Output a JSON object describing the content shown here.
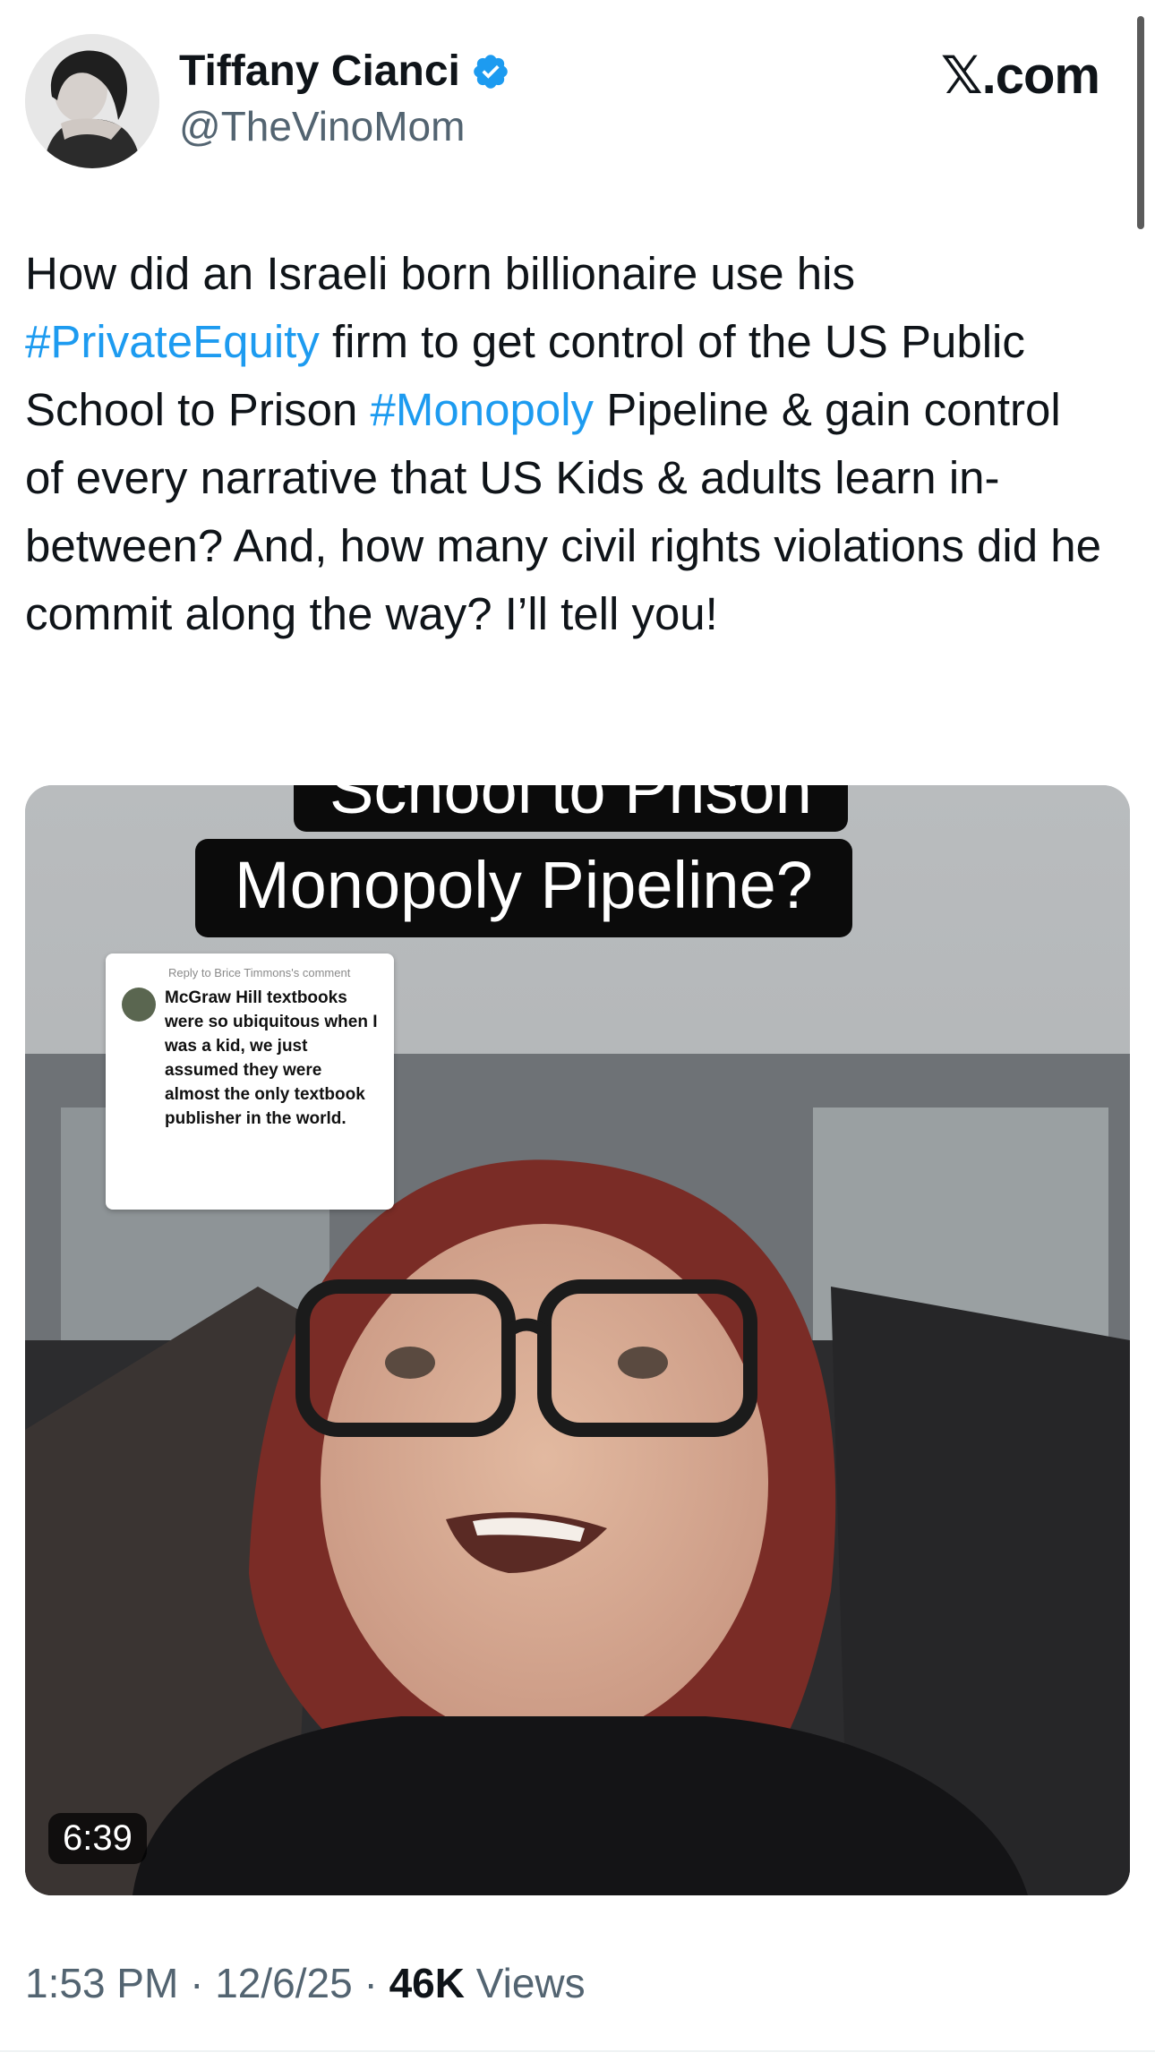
{
  "author": {
    "display_name": "Tiffany Cianci",
    "handle": "@TheVinoMom",
    "avatar_icon": "profile-photo",
    "verified_icon": "verified-badge-icon",
    "verified_color": "#1d9bf0"
  },
  "source_label": "𝕏.com",
  "tweet": {
    "text_1": "How did an Israeli born billionaire use his ",
    "hashtag_1": "#PrivateEquity",
    "text_2": " firm to get control of the US Public School to Prison ",
    "hashtag_2": "#Monopoly",
    "text_3": " Pipeline & gain control of every narrative that US Kids & adults learn in-between? And, how many civil rights violations did he commit along the way? I’ll tell you!",
    "hashtag_color": "#1d9bf0"
  },
  "video": {
    "caption_line_1": "School to Prison",
    "caption_line_2": "Monopoly Pipeline?",
    "reply_header": "Reply to Brice Timmons's comment",
    "reply_text": "McGraw Hill textbooks were so ubiquitous when I was a kid, we just assumed they were almost the only textbook publisher in the world.",
    "duration": "6:39"
  },
  "meta": {
    "time": "1:53 PM",
    "separator": " · ",
    "date": "12/6/25",
    "views_count": "46K",
    "views_label": " Views"
  }
}
